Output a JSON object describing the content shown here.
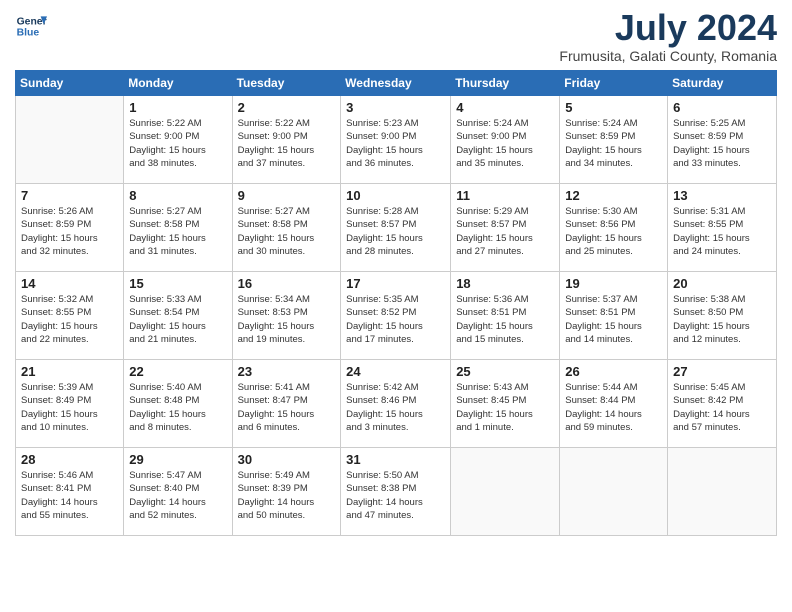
{
  "logo": {
    "line1": "General",
    "line2": "Blue"
  },
  "title": "July 2024",
  "location": "Frumusita, Galati County, Romania",
  "days_header": [
    "Sunday",
    "Monday",
    "Tuesday",
    "Wednesday",
    "Thursday",
    "Friday",
    "Saturday"
  ],
  "weeks": [
    [
      {
        "day": "",
        "info": ""
      },
      {
        "day": "1",
        "info": "Sunrise: 5:22 AM\nSunset: 9:00 PM\nDaylight: 15 hours\nand 38 minutes."
      },
      {
        "day": "2",
        "info": "Sunrise: 5:22 AM\nSunset: 9:00 PM\nDaylight: 15 hours\nand 37 minutes."
      },
      {
        "day": "3",
        "info": "Sunrise: 5:23 AM\nSunset: 9:00 PM\nDaylight: 15 hours\nand 36 minutes."
      },
      {
        "day": "4",
        "info": "Sunrise: 5:24 AM\nSunset: 9:00 PM\nDaylight: 15 hours\nand 35 minutes."
      },
      {
        "day": "5",
        "info": "Sunrise: 5:24 AM\nSunset: 8:59 PM\nDaylight: 15 hours\nand 34 minutes."
      },
      {
        "day": "6",
        "info": "Sunrise: 5:25 AM\nSunset: 8:59 PM\nDaylight: 15 hours\nand 33 minutes."
      }
    ],
    [
      {
        "day": "7",
        "info": "Sunrise: 5:26 AM\nSunset: 8:59 PM\nDaylight: 15 hours\nand 32 minutes."
      },
      {
        "day": "8",
        "info": "Sunrise: 5:27 AM\nSunset: 8:58 PM\nDaylight: 15 hours\nand 31 minutes."
      },
      {
        "day": "9",
        "info": "Sunrise: 5:27 AM\nSunset: 8:58 PM\nDaylight: 15 hours\nand 30 minutes."
      },
      {
        "day": "10",
        "info": "Sunrise: 5:28 AM\nSunset: 8:57 PM\nDaylight: 15 hours\nand 28 minutes."
      },
      {
        "day": "11",
        "info": "Sunrise: 5:29 AM\nSunset: 8:57 PM\nDaylight: 15 hours\nand 27 minutes."
      },
      {
        "day": "12",
        "info": "Sunrise: 5:30 AM\nSunset: 8:56 PM\nDaylight: 15 hours\nand 25 minutes."
      },
      {
        "day": "13",
        "info": "Sunrise: 5:31 AM\nSunset: 8:55 PM\nDaylight: 15 hours\nand 24 minutes."
      }
    ],
    [
      {
        "day": "14",
        "info": "Sunrise: 5:32 AM\nSunset: 8:55 PM\nDaylight: 15 hours\nand 22 minutes."
      },
      {
        "day": "15",
        "info": "Sunrise: 5:33 AM\nSunset: 8:54 PM\nDaylight: 15 hours\nand 21 minutes."
      },
      {
        "day": "16",
        "info": "Sunrise: 5:34 AM\nSunset: 8:53 PM\nDaylight: 15 hours\nand 19 minutes."
      },
      {
        "day": "17",
        "info": "Sunrise: 5:35 AM\nSunset: 8:52 PM\nDaylight: 15 hours\nand 17 minutes."
      },
      {
        "day": "18",
        "info": "Sunrise: 5:36 AM\nSunset: 8:51 PM\nDaylight: 15 hours\nand 15 minutes."
      },
      {
        "day": "19",
        "info": "Sunrise: 5:37 AM\nSunset: 8:51 PM\nDaylight: 15 hours\nand 14 minutes."
      },
      {
        "day": "20",
        "info": "Sunrise: 5:38 AM\nSunset: 8:50 PM\nDaylight: 15 hours\nand 12 minutes."
      }
    ],
    [
      {
        "day": "21",
        "info": "Sunrise: 5:39 AM\nSunset: 8:49 PM\nDaylight: 15 hours\nand 10 minutes."
      },
      {
        "day": "22",
        "info": "Sunrise: 5:40 AM\nSunset: 8:48 PM\nDaylight: 15 hours\nand 8 minutes."
      },
      {
        "day": "23",
        "info": "Sunrise: 5:41 AM\nSunset: 8:47 PM\nDaylight: 15 hours\nand 6 minutes."
      },
      {
        "day": "24",
        "info": "Sunrise: 5:42 AM\nSunset: 8:46 PM\nDaylight: 15 hours\nand 3 minutes."
      },
      {
        "day": "25",
        "info": "Sunrise: 5:43 AM\nSunset: 8:45 PM\nDaylight: 15 hours\nand 1 minute."
      },
      {
        "day": "26",
        "info": "Sunrise: 5:44 AM\nSunset: 8:44 PM\nDaylight: 14 hours\nand 59 minutes."
      },
      {
        "day": "27",
        "info": "Sunrise: 5:45 AM\nSunset: 8:42 PM\nDaylight: 14 hours\nand 57 minutes."
      }
    ],
    [
      {
        "day": "28",
        "info": "Sunrise: 5:46 AM\nSunset: 8:41 PM\nDaylight: 14 hours\nand 55 minutes."
      },
      {
        "day": "29",
        "info": "Sunrise: 5:47 AM\nSunset: 8:40 PM\nDaylight: 14 hours\nand 52 minutes."
      },
      {
        "day": "30",
        "info": "Sunrise: 5:49 AM\nSunset: 8:39 PM\nDaylight: 14 hours\nand 50 minutes."
      },
      {
        "day": "31",
        "info": "Sunrise: 5:50 AM\nSunset: 8:38 PM\nDaylight: 14 hours\nand 47 minutes."
      },
      {
        "day": "",
        "info": ""
      },
      {
        "day": "",
        "info": ""
      },
      {
        "day": "",
        "info": ""
      }
    ]
  ]
}
